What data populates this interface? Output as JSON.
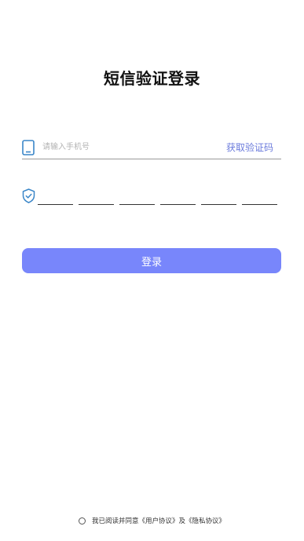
{
  "header": {
    "title": "短信验证登录"
  },
  "phone": {
    "placeholder": "请输入手机号",
    "value": "",
    "get_code_label": "获取验证码",
    "icon": "phone-icon"
  },
  "code": {
    "icon": "shield-check-icon",
    "cells": [
      "",
      "",
      "",
      "",
      "",
      ""
    ]
  },
  "login": {
    "label": "登录"
  },
  "agreement": {
    "prefix": "我已阅读并同意",
    "user_agreement": "《用户协议》",
    "conjunction": "及",
    "privacy_policy": "《隐私协议》",
    "checked": false
  },
  "colors": {
    "accent": "#7886fb",
    "link": "#6b7bdc",
    "icon": "#3a86c8"
  }
}
